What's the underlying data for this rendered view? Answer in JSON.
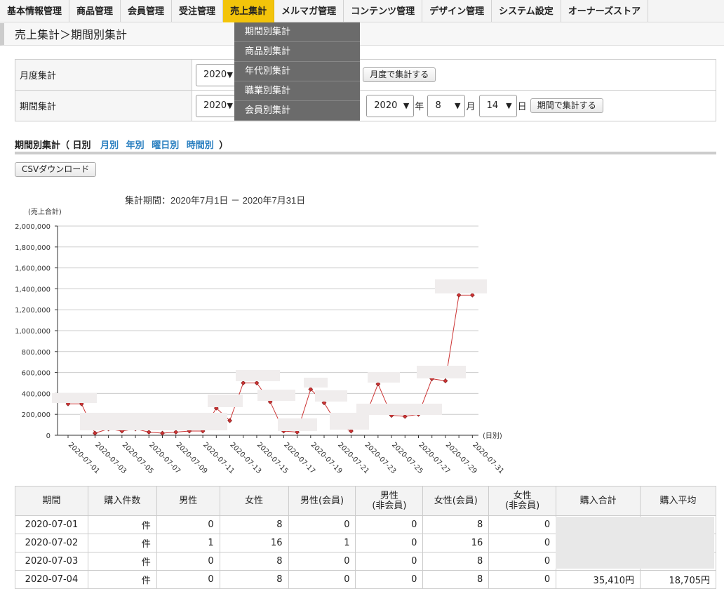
{
  "nav": {
    "items": [
      {
        "label": "基本情報管理",
        "name": "nav-basic-info"
      },
      {
        "label": "商品管理",
        "name": "nav-products"
      },
      {
        "label": "会員管理",
        "name": "nav-members"
      },
      {
        "label": "受注管理",
        "name": "nav-orders"
      },
      {
        "label": "売上集計",
        "name": "nav-sales",
        "active": true
      },
      {
        "label": "メルマガ管理",
        "name": "nav-mailmag"
      },
      {
        "label": "コンテンツ管理",
        "name": "nav-contents"
      },
      {
        "label": "デザイン管理",
        "name": "nav-design"
      },
      {
        "label": "システム設定",
        "name": "nav-system"
      },
      {
        "label": "オーナーズストア",
        "name": "nav-owners-store"
      }
    ],
    "dropdown": [
      "期間別集計",
      "商品別集計",
      "年代別集計",
      "職業別集計",
      "会員別集計"
    ]
  },
  "page_title": "売上集計＞期間別集計",
  "form": {
    "monthly_label": "月度集計",
    "monthly_year": "2020",
    "monthly_button": "月度で集計する",
    "period_label": "期間集計",
    "period_from_year": "2020",
    "period_to_year": "2020",
    "period_to_month": "8",
    "period_to_day": "14",
    "unit_year": "年",
    "unit_month": "月",
    "unit_day": "日",
    "period_button": "期間で集計する"
  },
  "subhead": {
    "prefix": "期間別集計（",
    "current": "日別",
    "links": [
      "月別",
      "年別",
      "曜日別",
      "時間別"
    ],
    "suffix": "）"
  },
  "csv_button": "CSVダウンロード",
  "chart_data": {
    "type": "line",
    "title": "集計期間：2020年7月1日 － 2020年7月31日",
    "ylabel": "(売上合計)",
    "xlabel": "(日別)",
    "ylim": [
      0,
      2000000
    ],
    "yticks": [
      "0",
      "200,000",
      "400,000",
      "600,000",
      "800,000",
      "1,000,000",
      "1,200,000",
      "1,400,000",
      "1,600,000",
      "1,800,000",
      "2,000,000"
    ],
    "x": [
      "2020-07-01",
      "2020-07-02",
      "2020-07-03",
      "2020-07-04",
      "2020-07-05",
      "2020-07-06",
      "2020-07-07",
      "2020-07-08",
      "2020-07-09",
      "2020-07-10",
      "2020-07-11",
      "2020-07-12",
      "2020-07-13",
      "2020-07-14",
      "2020-07-15",
      "2020-07-16",
      "2020-07-17",
      "2020-07-18",
      "2020-07-19",
      "2020-07-20",
      "2020-07-21",
      "2020-07-22",
      "2020-07-23",
      "2020-07-24",
      "2020-07-25",
      "2020-07-26",
      "2020-07-27",
      "2020-07-28",
      "2020-07-29",
      "2020-07-30",
      "2020-07-31"
    ],
    "xlabels_shown": [
      "2020-07-01",
      "2020-07-03",
      "2020-07-05",
      "2020-07-07",
      "2020-07-09",
      "2020-07-11",
      "2020-07-13",
      "2020-07-15",
      "2020-07-17",
      "2020-07-19",
      "2020-07-21",
      "2020-07-23",
      "2020-07-25",
      "2020-07-27",
      "2020-07-29",
      "2020-07-31"
    ],
    "values": [
      300000,
      300000,
      20000,
      60000,
      40000,
      60000,
      30000,
      20000,
      30000,
      40000,
      40000,
      260000,
      140000,
      500000,
      500000,
      320000,
      40000,
      30000,
      440000,
      310000,
      100000,
      40000,
      160000,
      490000,
      190000,
      180000,
      200000,
      540000,
      520000,
      1340000,
      1340000
    ],
    "color": "#cc3333"
  },
  "table": {
    "headers": [
      "期間",
      "購入件数",
      "男性",
      "女性",
      "男性(会員)",
      "男性\n(非会員)",
      "女性(会員)",
      "女性\n(非会員)",
      "購入合計",
      "購入平均"
    ],
    "rows": [
      [
        "2020-07-01",
        "件",
        "0",
        "8",
        "0",
        "0",
        "8",
        "0",
        "",
        ""
      ],
      [
        "2020-07-02",
        "件",
        "1",
        "16",
        "1",
        "0",
        "16",
        "0",
        "",
        ""
      ],
      [
        "2020-07-03",
        "件",
        "0",
        "8",
        "0",
        "0",
        "8",
        "0",
        "",
        ""
      ],
      [
        "2020-07-04",
        "件",
        "0",
        "8",
        "0",
        "0",
        "8",
        "0",
        "35,410円",
        "18,705円"
      ]
    ]
  }
}
